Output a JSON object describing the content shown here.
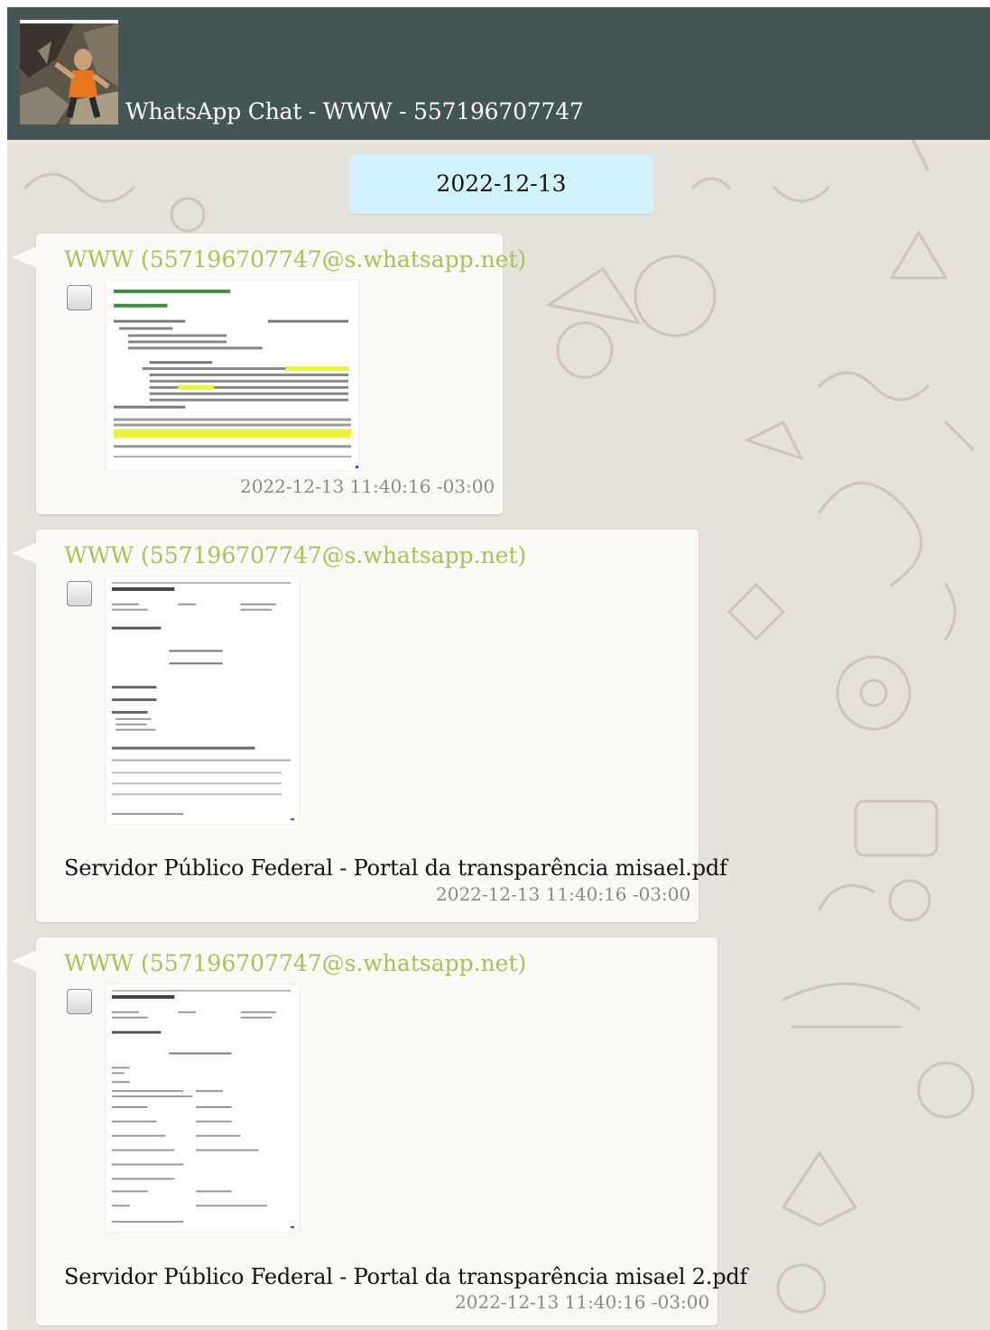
{
  "header": {
    "title": "WhatsApp Chat - WWW - 557196707747",
    "avatar_icon": "profile-photo"
  },
  "date_divider": "2022-12-13",
  "messages": [
    {
      "sender": "WWW (557196707747@s.whatsapp.net)",
      "attachment_type": "image",
      "timestamp": "2022-12-13 11:40:16 -03:00"
    },
    {
      "sender": "WWW (557196707747@s.whatsapp.net)",
      "attachment_type": "document",
      "filename": "Servidor Público Federal - Portal da transparência misael.pdf",
      "timestamp": "2022-12-13 11:40:16 -03:00"
    },
    {
      "sender": "WWW (557196707747@s.whatsapp.net)",
      "attachment_type": "document",
      "filename": "Servidor Público Federal - Portal da transparência misael 2.pdf",
      "timestamp": "2022-12-13 11:40:16 -03:00"
    }
  ],
  "colors": {
    "header_bg": "#445556",
    "chat_bg": "#e6e1d9",
    "bubble_bg": "#fbfaf6",
    "date_pill_bg": "#d3f1fb",
    "sender_color": "#a5c356",
    "timestamp_color": "#8a8a8a",
    "highlight_color": "#e8f43a"
  }
}
